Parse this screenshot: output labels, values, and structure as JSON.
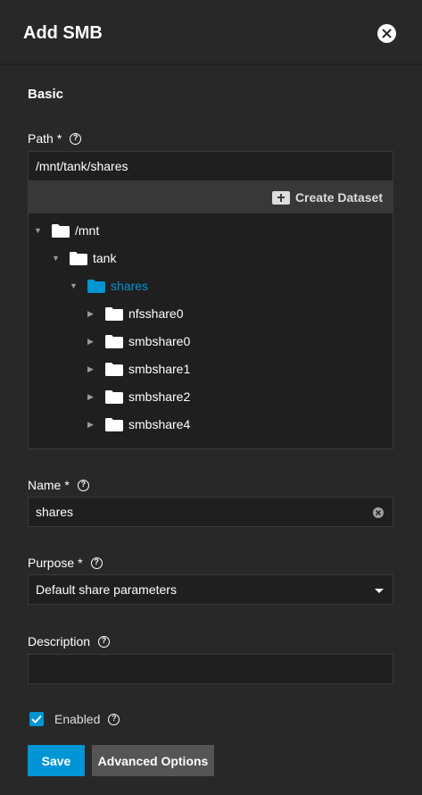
{
  "header": {
    "title": "Add SMB"
  },
  "section": {
    "title": "Basic"
  },
  "path": {
    "label": "Path",
    "required": "*",
    "value": "/mnt/tank/shares",
    "create_dataset_label": "Create Dataset",
    "tree": [
      {
        "label": "/mnt",
        "arrow": "▼"
      },
      {
        "label": "tank",
        "arrow": "▼"
      },
      {
        "label": "shares",
        "arrow": "▼"
      },
      {
        "label": "nfsshare0",
        "arrow": "▶"
      },
      {
        "label": "smbshare0",
        "arrow": "▶"
      },
      {
        "label": "smbshare1",
        "arrow": "▶"
      },
      {
        "label": "smbshare2",
        "arrow": "▶"
      },
      {
        "label": "smbshare4",
        "arrow": "▶"
      }
    ]
  },
  "name": {
    "label": "Name",
    "required": "*",
    "value": "shares"
  },
  "purpose": {
    "label": "Purpose",
    "required": "*",
    "value": "Default share parameters"
  },
  "description": {
    "label": "Description",
    "value": ""
  },
  "enabled": {
    "label": "Enabled",
    "checked": true
  },
  "buttons": {
    "save": "Save",
    "advanced": "Advanced Options"
  },
  "help_glyph": "?",
  "colors": {
    "accent": "#0095d5",
    "background": "#282828",
    "input": "#1f1f1f"
  }
}
